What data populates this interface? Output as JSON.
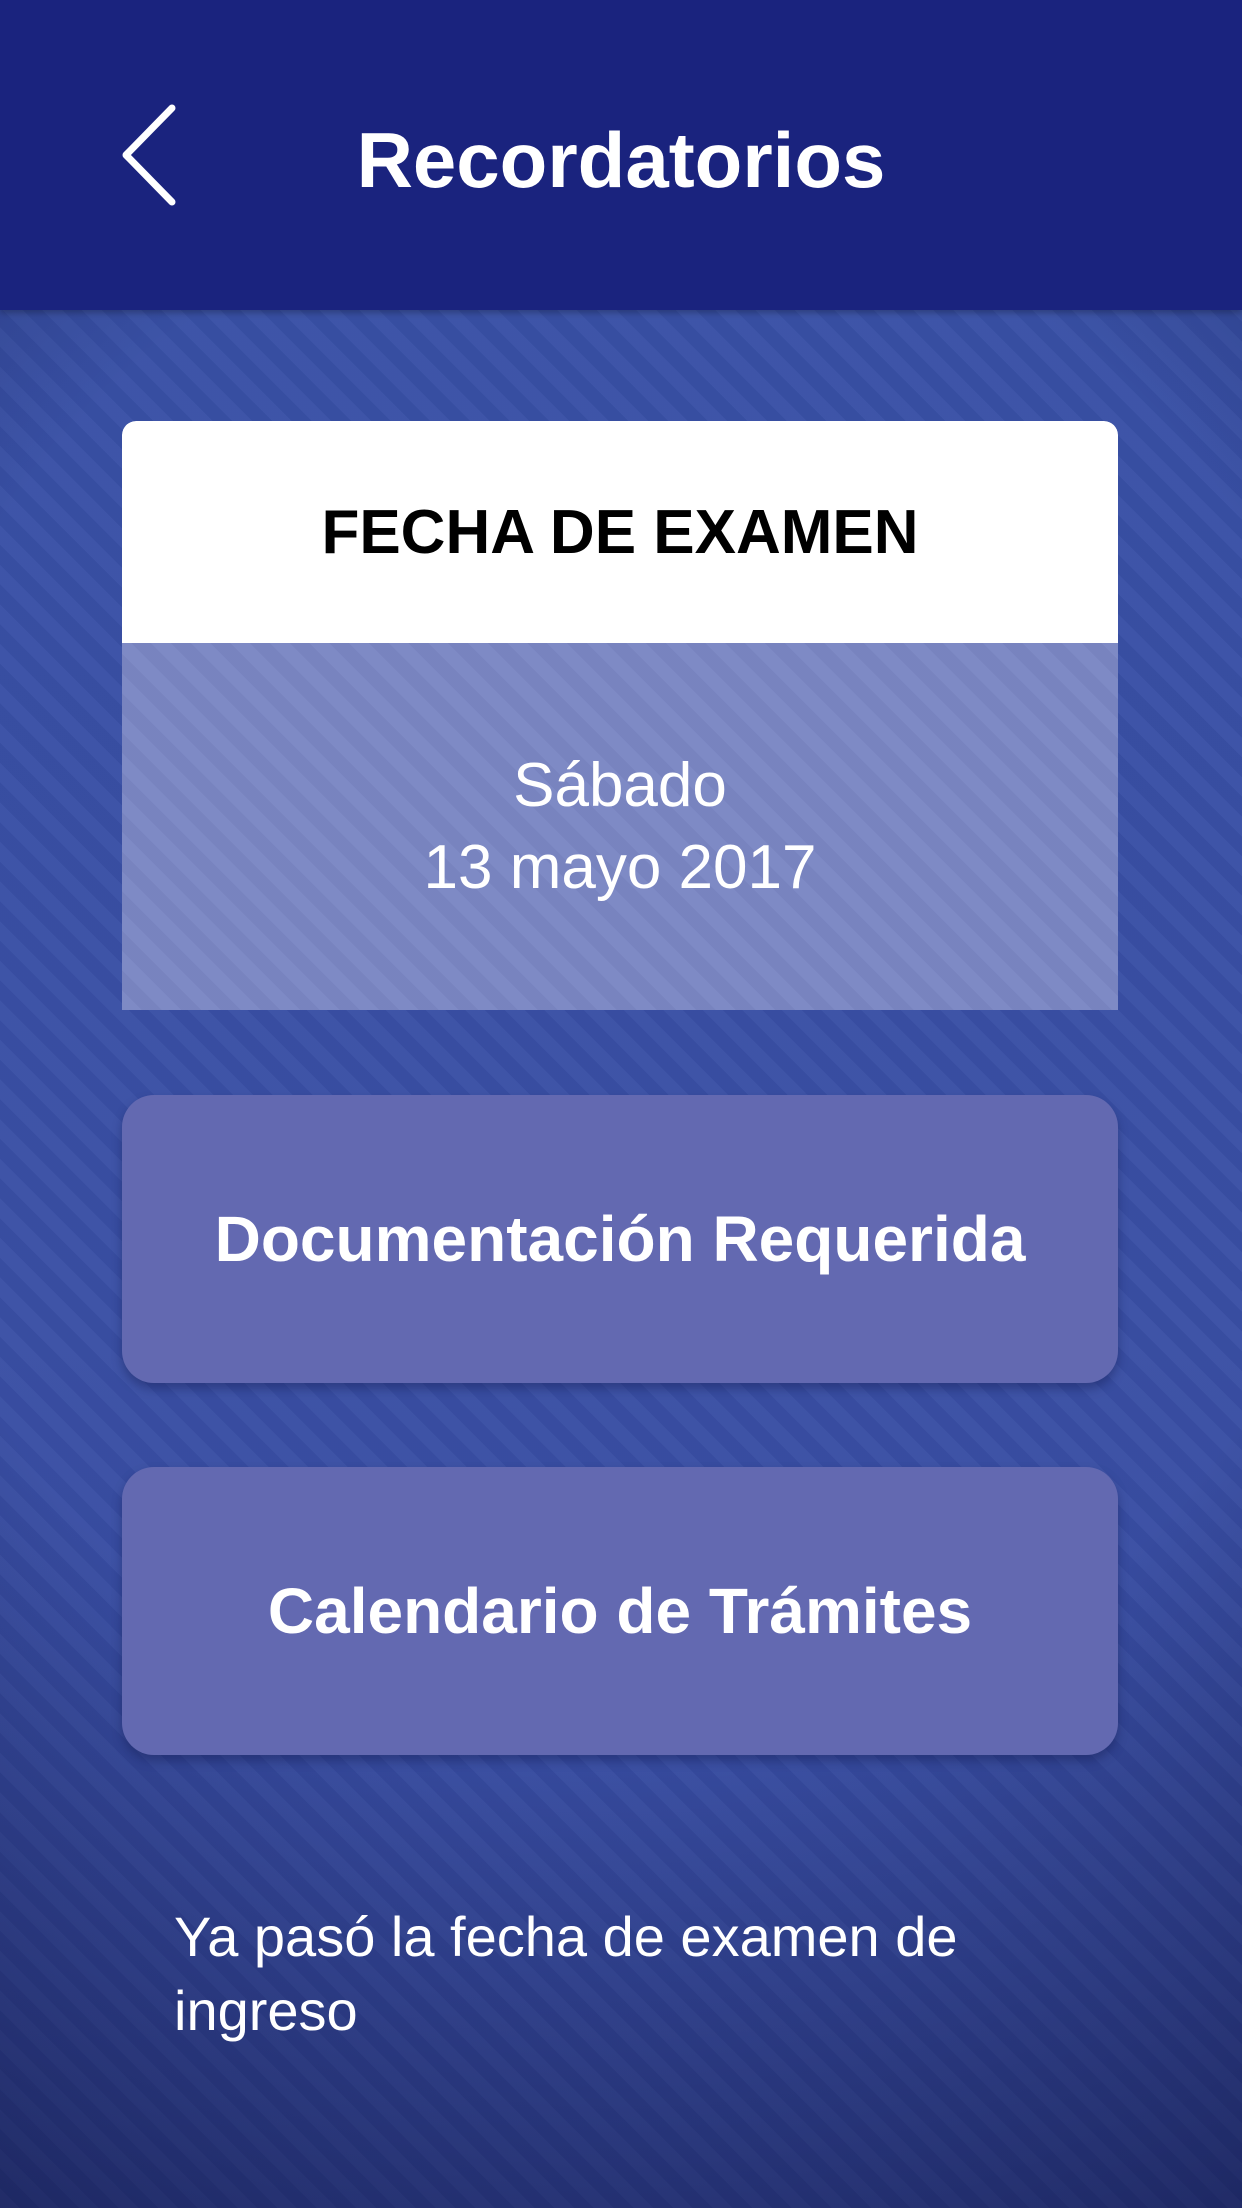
{
  "header": {
    "title": "Recordatorios",
    "back_icon": "chevron-left-icon"
  },
  "exam_card": {
    "title": "FECHA DE EXAMEN",
    "day": "Sábado",
    "date": "13 mayo 2017"
  },
  "buttons": {
    "documentation": "Documentación Requerida",
    "calendar": "Calendario de Trámites"
  },
  "note": "Ya pasó la fecha de examen de ingreso",
  "colors": {
    "header": "#1a237e",
    "background": "#3a4fa6",
    "card_body": "#7a86c3",
    "button": "#6369b1",
    "text_light": "#ffffff",
    "text_dark": "#000000"
  }
}
